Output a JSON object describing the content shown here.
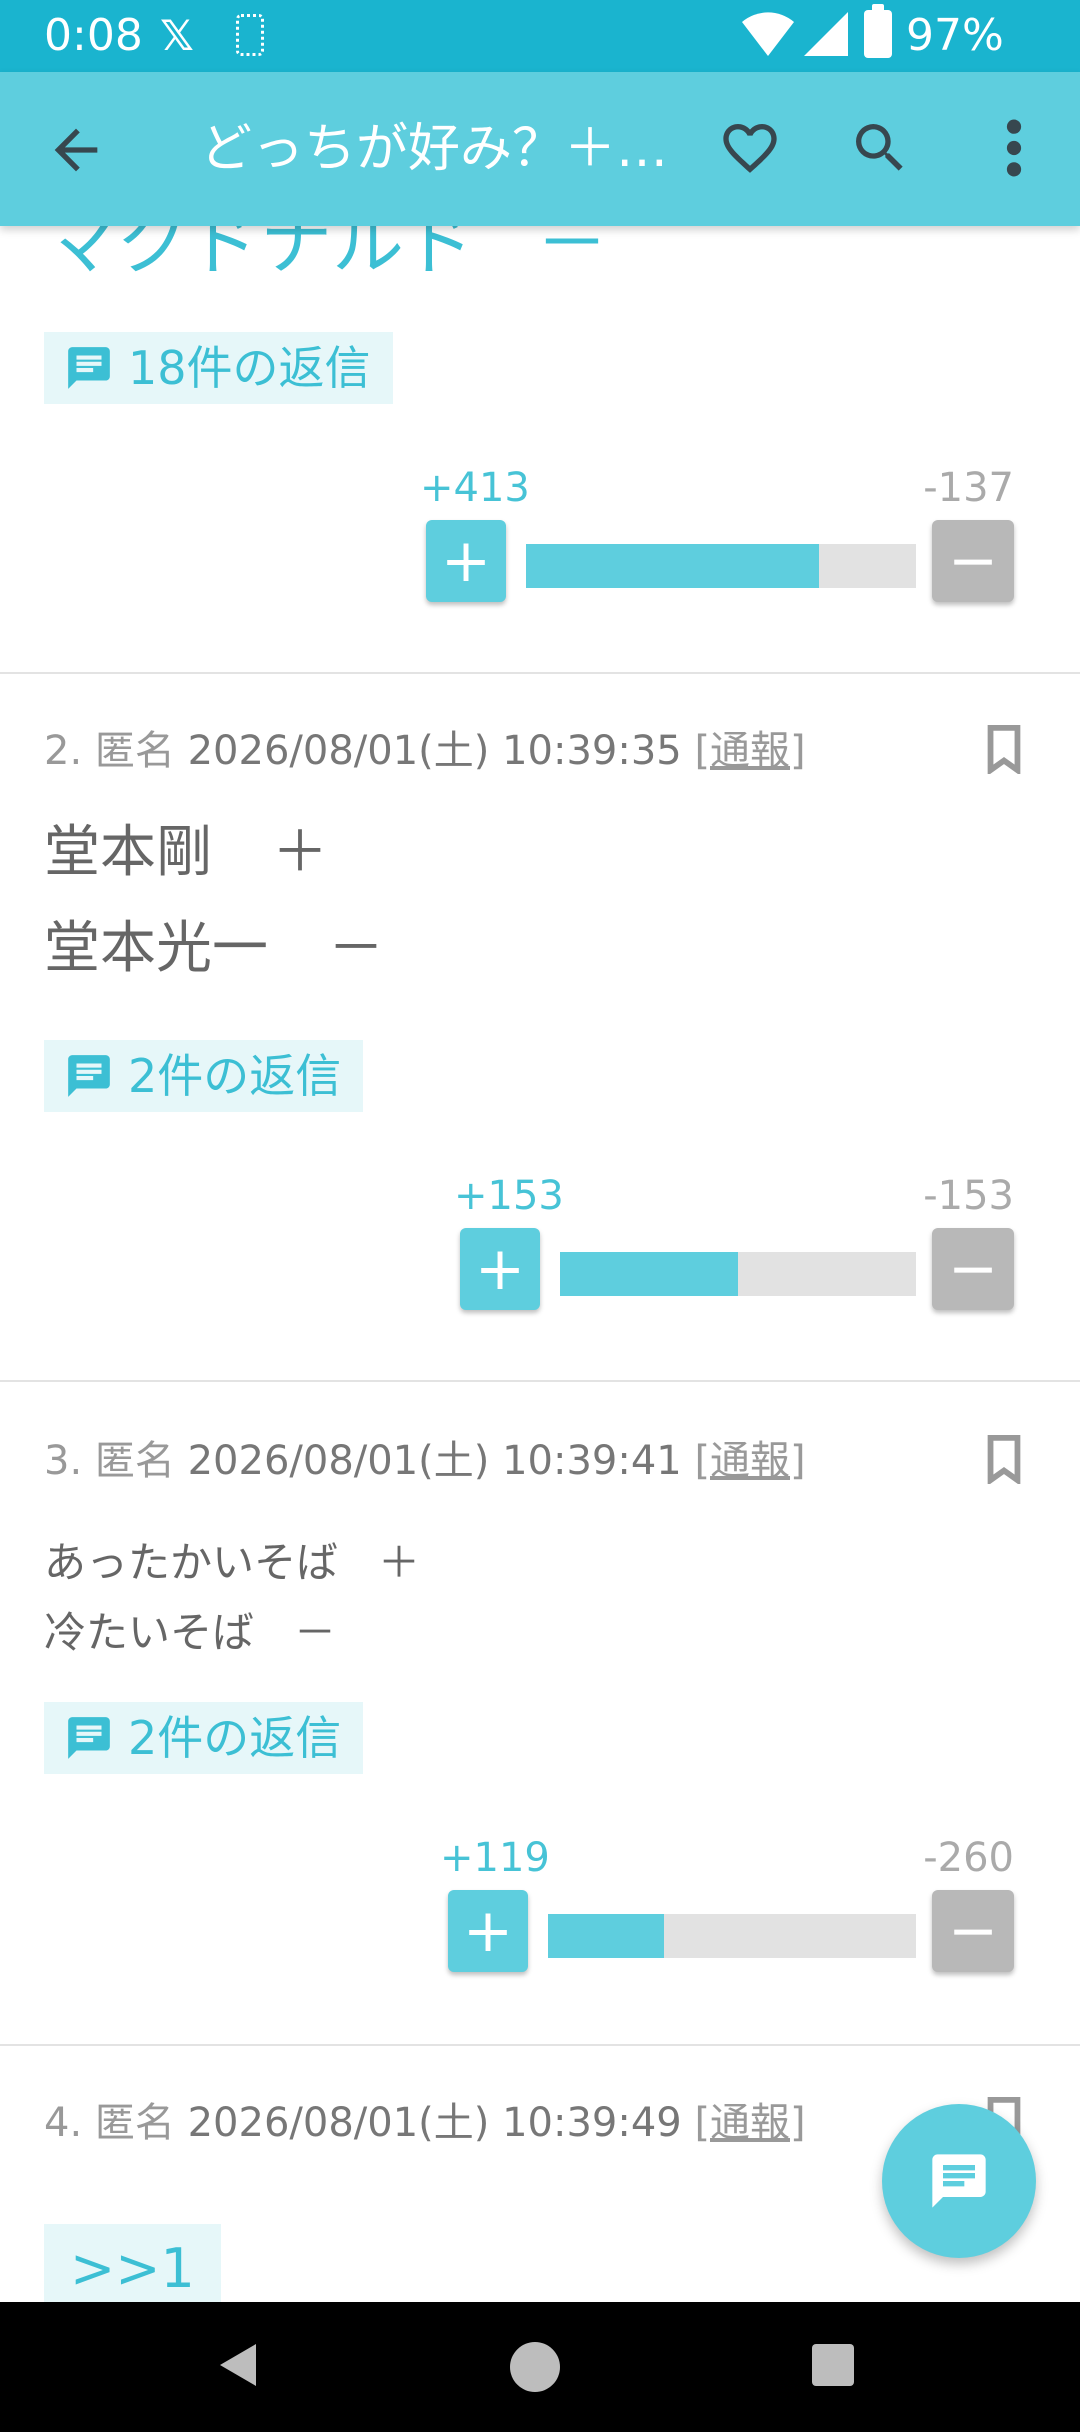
{
  "status_bar": {
    "time": "0:08",
    "x_logo": "𝕏",
    "battery_pct": "97%"
  },
  "app_bar": {
    "title": "どっちが好み？＋…"
  },
  "posts": [
    {
      "partial_text": "マクドナルド",
      "partial_mark": "－",
      "replies": "18件の返信",
      "plus": "+413",
      "minus": "-137",
      "plus_votes": 413,
      "minus_votes": 137
    },
    {
      "num": "2.",
      "anon": "匿名",
      "datetime": "2026/08/01(土) 10:39:35",
      "report": "[通報]",
      "lines": [
        {
          "text": "堂本剛",
          "mark": "＋"
        },
        {
          "text": "堂本光一",
          "mark": "－"
        }
      ],
      "replies": "2件の返信",
      "plus": "+153",
      "minus": "-153",
      "plus_votes": 153,
      "minus_votes": 153
    },
    {
      "num": "3.",
      "anon": "匿名",
      "datetime": "2026/08/01(土) 10:39:41",
      "report": "[通報]",
      "lines": [
        {
          "text": "あったかいそば",
          "mark": "＋"
        },
        {
          "text": "冷たいそば",
          "mark": "－"
        }
      ],
      "replies": "2件の返信",
      "plus": "+119",
      "minus": "-260",
      "plus_votes": 119,
      "minus_votes": 260
    },
    {
      "num": "4.",
      "anon": "匿名",
      "datetime": "2026/08/01(土) 10:39:49",
      "report": "[通報]",
      "anchor": ">>1"
    }
  ],
  "vote_buttons": {
    "plus_symbol": "+",
    "minus_symbol": "−"
  },
  "colors": {
    "accent": "#5ecede",
    "status_bar": "#1ab4cf",
    "minus_button": "#b8b8b8"
  },
  "icons": {
    "back": "arrow-left-icon",
    "favorite": "heart-icon",
    "search": "search-icon",
    "more": "more-vert-icon",
    "bookmark": "bookmark-icon",
    "reply": "comment-icon",
    "fab": "comment-icon"
  }
}
